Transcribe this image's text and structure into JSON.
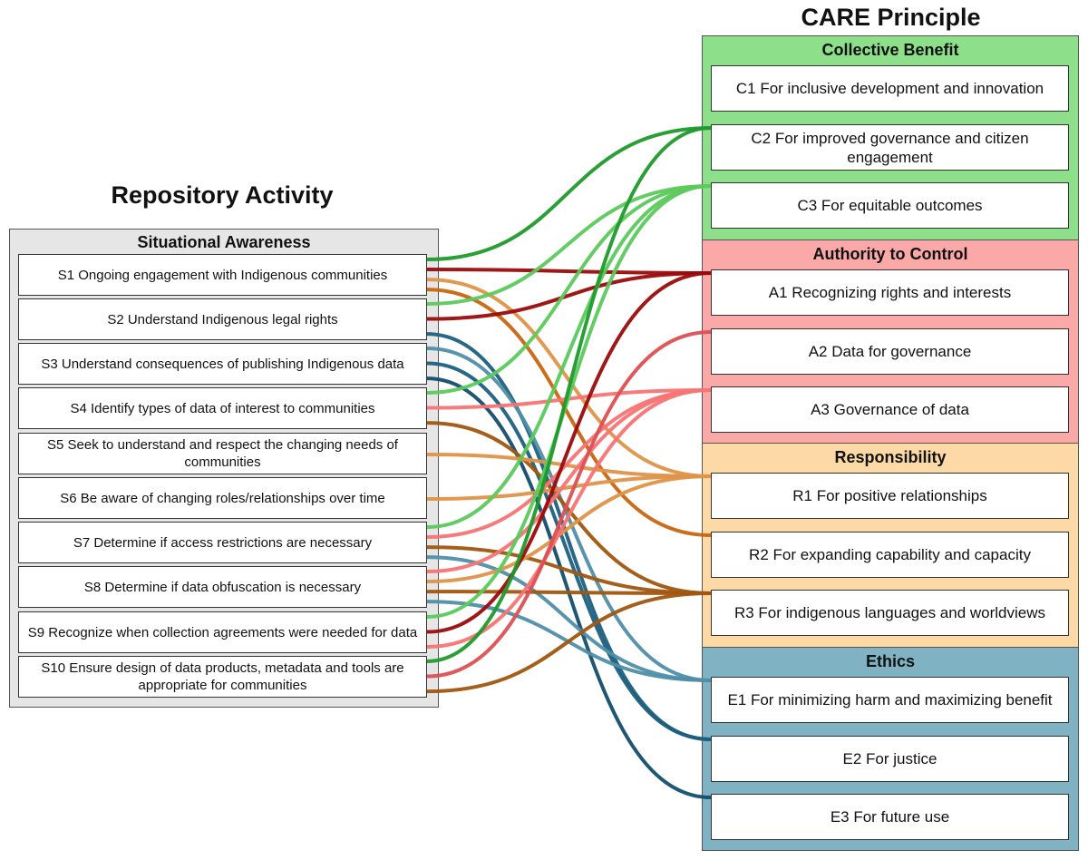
{
  "left_title": "Repository Activity",
  "right_title": "CARE Principle",
  "activity_group": {
    "label": "Situational Awareness",
    "items": [
      {
        "id": "S1",
        "label": "S1 Ongoing engagement with Indigenous communities"
      },
      {
        "id": "S2",
        "label": "S2 Understand Indigenous legal rights"
      },
      {
        "id": "S3",
        "label": "S3 Understand consequences of publishing Indigenous data"
      },
      {
        "id": "S4",
        "label": "S4 Identify types of data of interest to communities"
      },
      {
        "id": "S5",
        "label": "S5 Seek to understand and respect the changing needs of communities"
      },
      {
        "id": "S6",
        "label": "S6 Be aware of changing roles/relationships over time"
      },
      {
        "id": "S7",
        "label": "S7 Determine if access restrictions are necessary"
      },
      {
        "id": "S8",
        "label": "S8 Determine if data obfuscation is necessary"
      },
      {
        "id": "S9",
        "label": "S9 Recognize when collection agreements were needed for data"
      },
      {
        "id": "S10",
        "label": "S10 Ensure design of data products, metadata and tools are appropriate for communities"
      }
    ]
  },
  "principle_groups": [
    {
      "label": "Collective Benefit",
      "color": "#8ddf8a",
      "items": [
        {
          "id": "C1",
          "label": "C1 For inclusive development and innovation",
          "link_color": null
        },
        {
          "id": "C2",
          "label": "C2 For improved governance and citizen engagement",
          "link_color": "#1f9a2b"
        },
        {
          "id": "C3",
          "label": "C3 For equitable outcomes",
          "link_color": "#5cc95c"
        }
      ]
    },
    {
      "label": "Authority to Control",
      "color": "#fba8a8",
      "items": [
        {
          "id": "A1",
          "label": "A1 Recognizing rights and interests",
          "link_color": "#9b0b0b"
        },
        {
          "id": "A2",
          "label": "A2 Data for governance",
          "link_color": "#dd4f52"
        },
        {
          "id": "A3",
          "label": "A3 Governance of data",
          "link_color": "#f77474"
        }
      ]
    },
    {
      "label": "Responsibility",
      "color": "#fdd9a5",
      "items": [
        {
          "id": "R1",
          "label": "R1 For positive relationships",
          "link_color": "#df9449"
        },
        {
          "id": "R2",
          "label": "R2 For expanding capability and capacity",
          "link_color": "#c8650e"
        },
        {
          "id": "R3",
          "label": "R3 For indigenous languages and worldviews",
          "link_color": "#a0560f"
        }
      ]
    },
    {
      "label": "Ethics",
      "color": "#7fb3c3",
      "items": [
        {
          "id": "E1",
          "label": "E1 For minimizing harm and maximizing benefit",
          "link_color": "#4f8fa8"
        },
        {
          "id": "E2",
          "label": "E2 For justice",
          "link_color": "#1d5f80"
        },
        {
          "id": "E3",
          "label": "E3 For future use",
          "link_color": "#134d6b"
        }
      ]
    }
  ],
  "links": [
    {
      "from": "S1",
      "to": "C2"
    },
    {
      "from": "S1",
      "to": "A1"
    },
    {
      "from": "S1",
      "to": "R1"
    },
    {
      "from": "S1",
      "to": "R2"
    },
    {
      "from": "S2",
      "to": "C3"
    },
    {
      "from": "S2",
      "to": "A1"
    },
    {
      "from": "S2",
      "to": "E2"
    },
    {
      "from": "S3",
      "to": "E1"
    },
    {
      "from": "S3",
      "to": "E2"
    },
    {
      "from": "S3",
      "to": "E3"
    },
    {
      "from": "S4",
      "to": "C3"
    },
    {
      "from": "S4",
      "to": "A3"
    },
    {
      "from": "S4",
      "to": "R3"
    },
    {
      "from": "S5",
      "to": "R1"
    },
    {
      "from": "S6",
      "to": "R1"
    },
    {
      "from": "S7",
      "to": "C3"
    },
    {
      "from": "S7",
      "to": "A3"
    },
    {
      "from": "S7",
      "to": "R3"
    },
    {
      "from": "S7",
      "to": "E1"
    },
    {
      "from": "S8",
      "to": "A3"
    },
    {
      "from": "S8",
      "to": "R1"
    },
    {
      "from": "S8",
      "to": "R3"
    },
    {
      "from": "S8",
      "to": "E1"
    },
    {
      "from": "S9",
      "to": "C3"
    },
    {
      "from": "S9",
      "to": "A1"
    },
    {
      "from": "S9",
      "to": "A3"
    },
    {
      "from": "S10",
      "to": "C2"
    },
    {
      "from": "S10",
      "to": "A2"
    },
    {
      "from": "S10",
      "to": "R3"
    }
  ]
}
